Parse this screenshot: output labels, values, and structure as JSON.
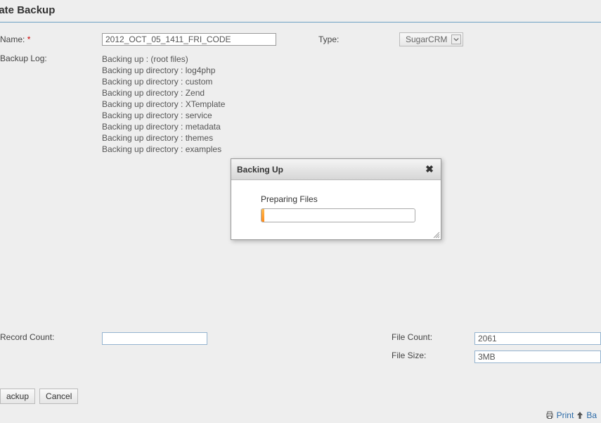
{
  "page": {
    "title": "eate Backup"
  },
  "form": {
    "name_label": "Name:",
    "name_value": "2012_OCT_05_1411_FRI_CODE",
    "type_label": "Type:",
    "type_value": "SugarCRM",
    "log_label": "Backup Log:",
    "log_lines": [
      "Backing up : (root files)",
      "Backing up directory : log4php",
      "Backing up directory : custom",
      "Backing up directory : Zend",
      "Backing up directory : XTemplate",
      "Backing up directory : service",
      "Backing up directory : metadata",
      "Backing up directory : themes",
      "Backing up directory : examples"
    ],
    "record_count_label": "Record Count:",
    "record_count_value": "",
    "file_count_label": "File Count:",
    "file_count_value": "2061",
    "file_size_label": "File Size:",
    "file_size_value": "3MB"
  },
  "buttons": {
    "backup": "ackup",
    "cancel": "Cancel"
  },
  "modal": {
    "title": "Backing Up",
    "body_label": "Preparing Files",
    "progress_percent": 2
  },
  "footer": {
    "print": "Print",
    "back": "Ba"
  }
}
